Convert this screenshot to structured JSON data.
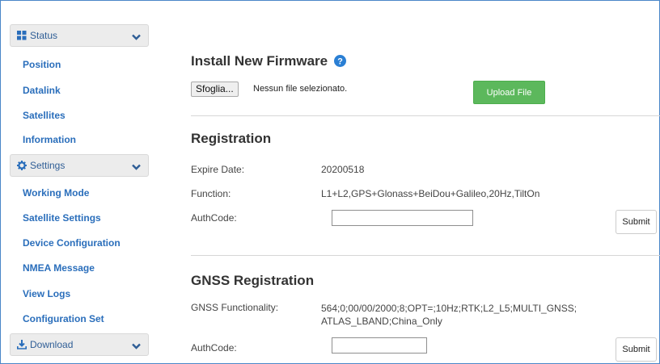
{
  "sidebar": {
    "groups": [
      {
        "label": "Status",
        "icon": "dashboard-icon",
        "items": [
          "Position",
          "Datalink",
          "Satellites",
          "Information"
        ]
      },
      {
        "label": "Settings",
        "icon": "gear-icon",
        "items": [
          "Working Mode",
          "Satellite Settings",
          "Device Configuration",
          "NMEA Message",
          "View Logs",
          "Configuration Set"
        ]
      },
      {
        "label": "Download",
        "icon": "download-icon",
        "items": []
      }
    ]
  },
  "firmware": {
    "title": "Install New Firmware",
    "help_icon": "question-circle-icon",
    "browse_label": "Sfoglia...",
    "file_status": "Nessun file selezionato.",
    "upload_label": "Upload File"
  },
  "registration": {
    "title": "Registration",
    "expire_label": "Expire Date:",
    "expire_value": "20200518",
    "function_label": "Function:",
    "function_value": "L1+L2,GPS+Glonass+BeiDou+Galileo,20Hz,TiltOn",
    "authcode_label": "AuthCode:",
    "authcode_value": "",
    "submit_label": "Submit"
  },
  "gnss": {
    "title": "GNSS Registration",
    "functionality_label": "GNSS Functionality:",
    "functionality_line1": "564;0;00/00/2000;8;OPT=;10Hz;RTK;L2_L5;MULTI_GNSS;",
    "functionality_line2": "ATLAS_LBAND;China_Only",
    "authcode_label": "AuthCode:",
    "authcode_value": "",
    "submit_label": "Submit"
  },
  "colors": {
    "link": "#2a6ebb",
    "header_bg": "#ececec",
    "upload_button": "#5cb85c",
    "help_icon": "#2a7fd4",
    "frame_border": "#4a86c8"
  }
}
